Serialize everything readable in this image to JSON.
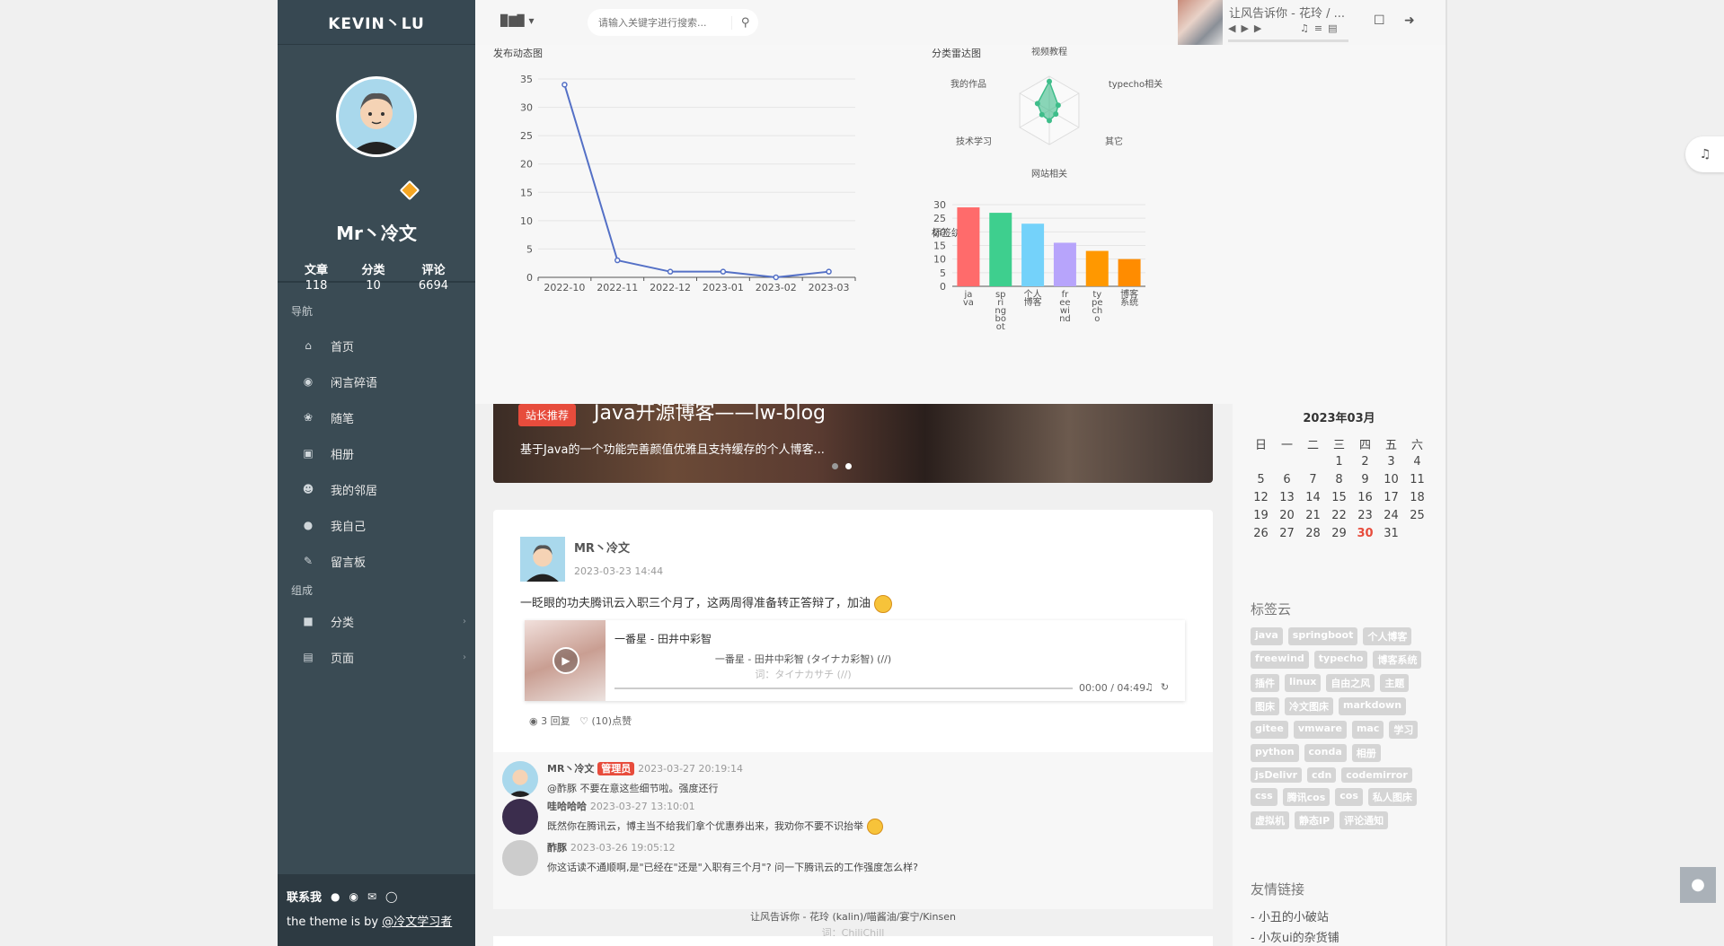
{
  "sidebar": {
    "brand": "KEVIN丶LU",
    "username": "Mr丶冷文",
    "stats": [
      {
        "label": "文章",
        "value": "118"
      },
      {
        "label": "分类",
        "value": "10"
      },
      {
        "label": "评论",
        "value": "6694"
      }
    ],
    "nav_header": "导航",
    "nav_items": [
      {
        "label": "首页",
        "icon": "home-icon"
      },
      {
        "label": "闲言碎语",
        "icon": "comment-icon"
      },
      {
        "label": "随笔",
        "icon": "feather-icon"
      },
      {
        "label": "相册",
        "icon": "image-icon"
      },
      {
        "label": "我的邻居",
        "icon": "group-icon"
      },
      {
        "label": "我自己",
        "icon": "user-icon"
      },
      {
        "label": "留言板",
        "icon": "edit-icon"
      }
    ],
    "compose_header": "组成",
    "compose_items": [
      {
        "label": "分类",
        "icon": "folder-icon"
      },
      {
        "label": "页面",
        "icon": "file-icon"
      }
    ],
    "contact_label": "联系我",
    "credit_prefix": "the theme is by ",
    "credit_link": "@冷文学习者"
  },
  "topbar": {
    "search_placeholder": "请输入关键字进行搜索...",
    "player_title": "让风告诉你 - 花玲 / ..."
  },
  "charts": {
    "line_title": "发布动态图",
    "radar_title": "分类雷达图",
    "bar_title": "标签统计"
  },
  "chart_data": [
    {
      "type": "line",
      "title": "发布动态图",
      "categories": [
        "2022-10",
        "2022-11",
        "2022-12",
        "2023-01",
        "2023-02",
        "2023-03"
      ],
      "values": [
        34,
        3,
        1,
        1,
        0,
        1
      ],
      "ylim": [
        0,
        35
      ],
      "yticks": [
        0,
        5,
        10,
        15,
        20,
        25,
        30,
        35
      ],
      "color": "#5470c6"
    },
    {
      "type": "radar",
      "title": "分类雷达图",
      "indicators": [
        "视频教程",
        "typecho相关",
        "其它",
        "网站相关",
        "技术学习",
        "我的作品"
      ],
      "values": [
        0.85,
        0.3,
        0.22,
        0.3,
        0.25,
        0.4
      ],
      "color": "#3ebd8a"
    },
    {
      "type": "bar",
      "title": "标签统计",
      "categories": [
        "java",
        "springboot",
        "个人博客",
        "freewind",
        "typecho",
        "博客系统"
      ],
      "category_lines": [
        [
          "ja",
          "va"
        ],
        [
          "sp",
          "ri",
          "ng",
          "bo",
          "ot"
        ],
        [
          "个人",
          "博客"
        ],
        [
          "fr",
          "ee",
          "wi",
          "nd"
        ],
        [
          "ty",
          "pe",
          "ch",
          "o"
        ],
        [
          "博客",
          "系统"
        ]
      ],
      "values": [
        29,
        27,
        23,
        16,
        13,
        10
      ],
      "ylim": [
        0,
        30
      ],
      "yticks": [
        0,
        5,
        10,
        15,
        20,
        25,
        30
      ],
      "colors": [
        "#ff6b6b",
        "#3ecf8e",
        "#74d2fa",
        "#b7a4fb",
        "#ff9800",
        "#ff8c00"
      ]
    }
  ],
  "banner": {
    "tag": "站长推荐",
    "title": "Java开源博客——lw-blog",
    "desc": "基于Java的一个功能完善颜值优雅且支持缓存的个人博客..."
  },
  "post": {
    "author": "MR丶冷文",
    "date": "2023-03-23 14:44",
    "text": "一眨眼的功夫腾讯云入职三个月了，这两周得准备转正答辩了，加油",
    "music_title": "一番星 - 田井中彩智",
    "music_lyric": "一番星 - 田井中彩智 (タイナカ彩智) (//)",
    "music_lyric2": "词：タイナカサチ (//)",
    "music_time": "00:00 / 04:49",
    "replies": "3 回复",
    "likes": "(10)点赞"
  },
  "comments": [
    {
      "name": "MR丶冷文",
      "admin": "管理员",
      "time": "2023-03-27 20:19:14",
      "text": "@酢豚 不要在意这些细节啦。强度还行"
    },
    {
      "name": "哇哈哈哈",
      "admin": "",
      "time": "2023-03-27 13:10:01",
      "text": "既然你在腾讯云，博主当不给我们拿个优惠券出来，我劝你不要不识抬举"
    },
    {
      "name": "酢豚",
      "admin": "",
      "time": "2023-03-26 19:05:12",
      "text": "你这话读不通顺啊,是\"已经在\"还是\"入职有三个月\"? 问一下腾讯云的工作强度怎么样?"
    }
  ],
  "bottom_lyric": {
    "line1": "让风告诉你 - 花玲 (kalin)/喵酱油/宴宁/Kinsen",
    "line2": "词：ChiliChill"
  },
  "calendar": {
    "title": "2023年03月",
    "weekdays": [
      "日",
      "一",
      "二",
      "三",
      "四",
      "五",
      "六"
    ],
    "weeks": [
      [
        "",
        "",
        "",
        "1",
        "2",
        "3",
        "4"
      ],
      [
        "5",
        "6",
        "7",
        "8",
        "9",
        "10",
        "11"
      ],
      [
        "12",
        "13",
        "14",
        "15",
        "16",
        "17",
        "18"
      ],
      [
        "19",
        "20",
        "21",
        "22",
        "23",
        "24",
        "25"
      ],
      [
        "26",
        "27",
        "28",
        "29",
        "30",
        "31",
        ""
      ]
    ],
    "today": "30"
  },
  "tagcloud": {
    "title": "标签云",
    "tags": [
      "java",
      "springboot",
      "个人博客",
      "freewind",
      "typecho",
      "博客系统",
      "插件",
      "linux",
      "自由之风",
      "主题",
      "图床",
      "冷文图床",
      "markdown",
      "gitee",
      "vmware",
      "mac",
      "学习",
      "python",
      "conda",
      "相册",
      "jsDelivr",
      "cdn",
      "codemirror",
      "css",
      "腾讯cos",
      "cos",
      "私人图床",
      "虚拟机",
      "静态IP",
      "评论通知"
    ]
  },
  "links": {
    "title": "友情链接",
    "items": [
      "-  小丑的小破站",
      "-  小灰ui的杂货铺"
    ]
  }
}
